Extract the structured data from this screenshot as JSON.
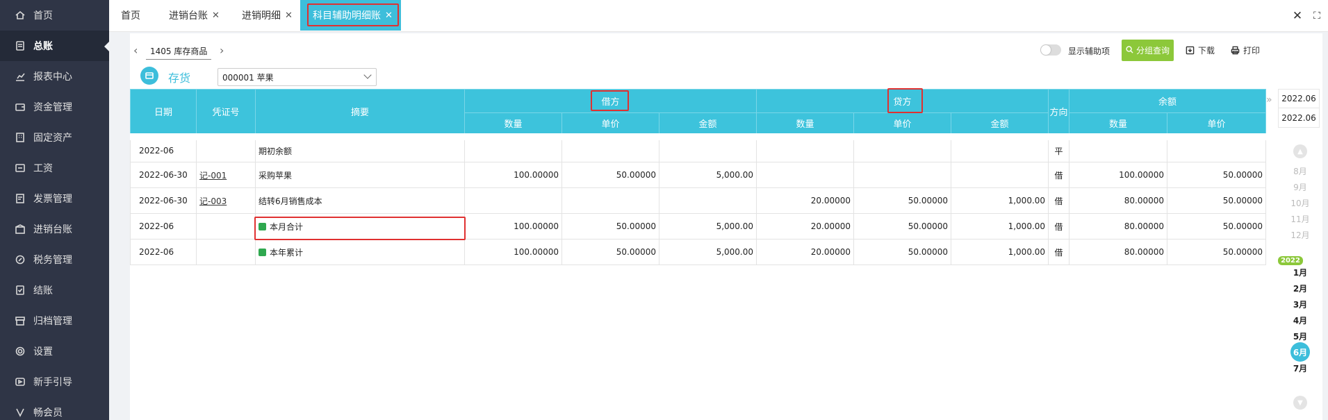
{
  "sidebar": {
    "items": [
      {
        "label": "首页",
        "icon": "home-icon"
      },
      {
        "label": "总账",
        "icon": "ledger-icon"
      },
      {
        "label": "报表中心",
        "icon": "chart-icon"
      },
      {
        "label": "资金管理",
        "icon": "wallet-icon"
      },
      {
        "label": "固定资产",
        "icon": "building-icon"
      },
      {
        "label": "工资",
        "icon": "salary-icon"
      },
      {
        "label": "发票管理",
        "icon": "invoice-icon"
      },
      {
        "label": "进销台账",
        "icon": "inventory-icon"
      },
      {
        "label": "税务管理",
        "icon": "tax-icon"
      },
      {
        "label": "结账",
        "icon": "checkout-icon"
      },
      {
        "label": "归档管理",
        "icon": "archive-icon"
      },
      {
        "label": "设置",
        "icon": "gear-icon"
      },
      {
        "label": "新手引导",
        "icon": "guide-icon"
      },
      {
        "label": "畅会员",
        "icon": "vip-icon"
      }
    ]
  },
  "tabs": [
    {
      "label": "首页",
      "closable": false
    },
    {
      "label": "进销台账",
      "closable": true
    },
    {
      "label": "进销明细",
      "closable": true
    },
    {
      "label": "科目辅助明细账",
      "closable": true
    }
  ],
  "toolbar": {
    "subject": "1405  库存商品",
    "stock_label": "存货",
    "item_select": "000001  苹果",
    "toggle_label": "显示辅助项",
    "group_query": "分组查询",
    "download": "下载",
    "print": "打印"
  },
  "table": {
    "headers": {
      "date": "日期",
      "voucher": "凭证号",
      "summary": "摘要",
      "debit": "借方",
      "credit": "贷方",
      "direction": "方向",
      "balance": "余额",
      "qty": "数量",
      "price": "单价",
      "amount": "金额"
    },
    "rows": [
      {
        "date": "2022-06",
        "voucher": "",
        "summary": "期初余额",
        "d_qty": "",
        "d_price": "",
        "d_amt": "",
        "c_qty": "",
        "c_price": "",
        "c_amt": "",
        "dir": "平",
        "b_qty": "",
        "b_price": ""
      },
      {
        "date": "2022-06-30",
        "voucher": "记-001",
        "summary": "采购苹果",
        "d_qty": "100.00000",
        "d_price": "50.00000",
        "d_amt": "5,000.00",
        "c_qty": "",
        "c_price": "",
        "c_amt": "",
        "dir": "借",
        "b_qty": "100.00000",
        "b_price": "50.00000"
      },
      {
        "date": "2022-06-30",
        "voucher": "记-003",
        "summary": "结转6月销售成本",
        "d_qty": "",
        "d_price": "",
        "d_amt": "",
        "c_qty": "20.00000",
        "c_price": "50.00000",
        "c_amt": "1,000.00",
        "dir": "借",
        "b_qty": "80.00000",
        "b_price": "50.00000"
      },
      {
        "date": "2022-06",
        "voucher": "",
        "summary": "本月合计",
        "d_qty": "100.00000",
        "d_price": "50.00000",
        "d_amt": "5,000.00",
        "c_qty": "20.00000",
        "c_price": "50.00000",
        "c_amt": "1,000.00",
        "dir": "借",
        "b_qty": "80.00000",
        "b_price": "50.00000"
      },
      {
        "date": "2022-06",
        "voucher": "",
        "summary": "本年累计",
        "d_qty": "100.00000",
        "d_price": "50.00000",
        "d_amt": "5,000.00",
        "c_qty": "20.00000",
        "c_price": "50.00000",
        "c_amt": "1,000.00",
        "dir": "借",
        "b_qty": "80.00000",
        "b_price": "50.00000"
      }
    ]
  },
  "date_rail": {
    "start": "2022.06",
    "end": "2022.06",
    "year": "2022",
    "prev_months": [
      "8月",
      "9月",
      "10月",
      "11月",
      "12月"
    ],
    "months": [
      "1月",
      "2月",
      "3月",
      "4月",
      "5月",
      "6月",
      "7月"
    ],
    "current": "6月"
  },
  "colors": {
    "accent": "#3dbedb",
    "green": "#8cc83a",
    "sidebar": "#2f3546",
    "highlight": "#e03030"
  }
}
